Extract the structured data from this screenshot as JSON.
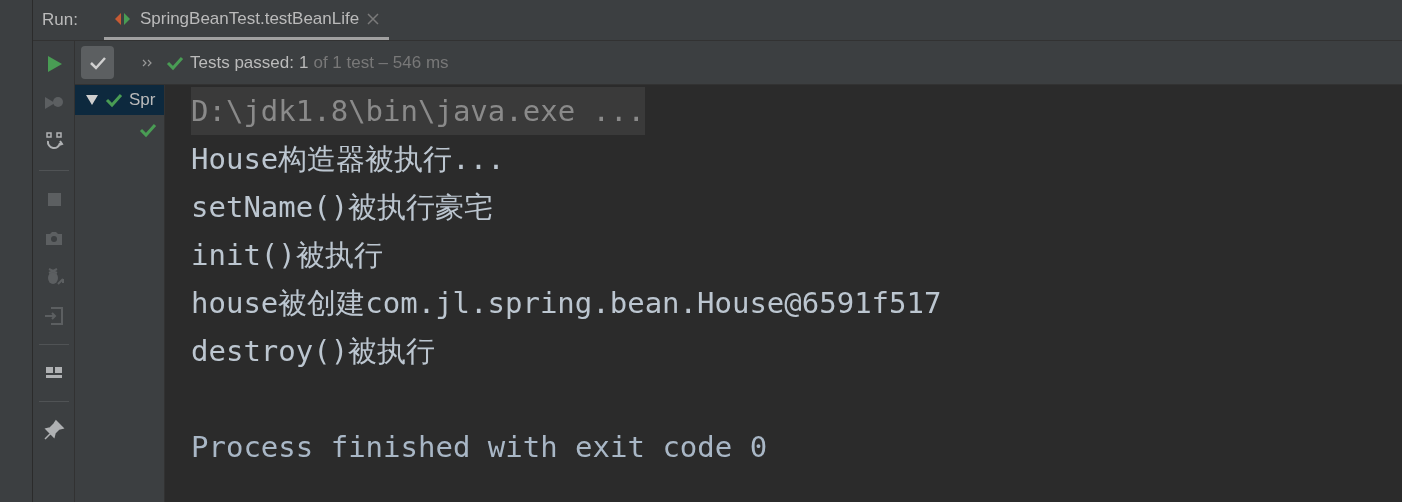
{
  "run_label": "Run:",
  "tab": {
    "title": "SpringBeanTest.testBeanLife",
    "selected": true
  },
  "status": {
    "passed": true,
    "label": "Tests passed:",
    "count": "1",
    "rest": "of 1 test – 546 ms"
  },
  "tools": [
    {
      "kind": "rerun",
      "disabled": false
    },
    {
      "kind": "rerun-failed",
      "disabled": true
    },
    {
      "kind": "toggle-auto",
      "disabled": false
    },
    {
      "kind": "stop",
      "disabled": true
    },
    {
      "kind": "snapshot",
      "disabled": true
    },
    {
      "kind": "debug",
      "disabled": true
    },
    {
      "kind": "exit",
      "disabled": true
    },
    {
      "kind": "layout",
      "disabled": false
    },
    {
      "kind": "pin",
      "disabled": false
    }
  ],
  "tree": [
    {
      "label": "Spr",
      "passed": true,
      "selected": true,
      "expanded": true,
      "children": [
        {
          "passed": true,
          "selected": false
        }
      ]
    }
  ],
  "console": [
    {
      "kind": "command",
      "text": "D:\\jdk1.8\\bin\\java.exe ..."
    },
    {
      "kind": "output",
      "text": "House构造器被执行..."
    },
    {
      "kind": "output",
      "text": "setName()被执行豪宅"
    },
    {
      "kind": "output",
      "text": "init()被执行"
    },
    {
      "kind": "output",
      "text": "house被创建com.jl.spring.bean.House@6591f517"
    },
    {
      "kind": "output",
      "text": "destroy()被执行"
    },
    {
      "kind": "exit",
      "text": "Process finished with exit code 0"
    }
  ]
}
